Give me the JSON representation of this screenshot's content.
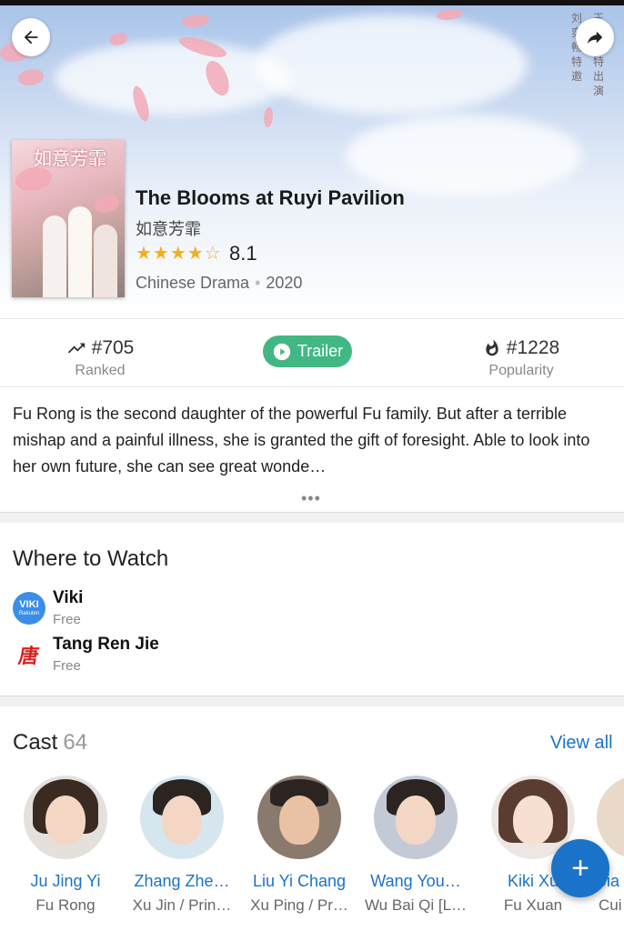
{
  "show": {
    "title": "The Blooms at Ruyi Pavilion",
    "native_title": "如意芳霏",
    "poster_title": "如意芳霏",
    "stars": "★★★★☆",
    "rating": "8.1",
    "category": "Chinese Drama",
    "year": "2020"
  },
  "stats": {
    "ranked_value": "#705",
    "ranked_label": "Ranked",
    "trailer_label": "Trailer",
    "popularity_value": "#1228",
    "popularity_label": "Popularity"
  },
  "synopsis": {
    "text": "Fu Rong is the second daughter of the powerful Fu family. But after a terrible mishap and a painful illness, she is granted the gift of foresight. Able to look into her own future, she can see great wonde…",
    "more": "•••"
  },
  "where_to_watch": {
    "title": "Where to Watch",
    "providers": [
      {
        "name": "Viki",
        "price": "Free",
        "logo_text": "VIKI",
        "logo_sub": "Rakuten"
      },
      {
        "name": "Tang Ren Jie",
        "price": "Free",
        "logo_text": "唐"
      }
    ]
  },
  "cast": {
    "title": "Cast",
    "count": "64",
    "view_all": "View all",
    "members": [
      {
        "name": "Ju Jing Yi",
        "role": "Fu Rong"
      },
      {
        "name": "Zhang Zhe…",
        "role": "Xu Jin / Prin…"
      },
      {
        "name": "Liu Yi Chang",
        "role": "Xu Ping / Pr…"
      },
      {
        "name": "Wang You…",
        "role": "Wu Bai Qi [L…"
      },
      {
        "name": "Kiki Xu",
        "role": "Fu Xuan"
      },
      {
        "name": "Jia",
        "role": "Cui"
      }
    ]
  },
  "fab_label": "+",
  "colors": {
    "accent": "#1a73c8",
    "trailer": "#41b883",
    "star": "#f2b01e"
  }
}
